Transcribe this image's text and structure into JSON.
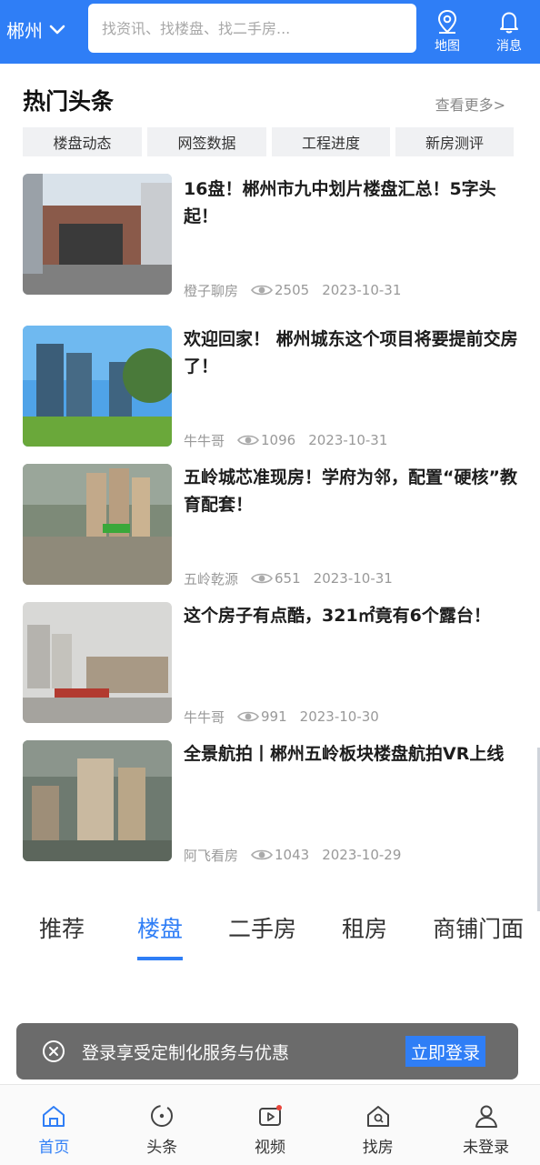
{
  "header": {
    "city": "郴州",
    "search_placeholder": "找资讯、找楼盘、找二手房...",
    "map_label": "地图",
    "message_label": "消息"
  },
  "section": {
    "title": "热门头条",
    "more": "查看更多>",
    "tags": [
      "楼盘动态",
      "网签数据",
      "工程进度",
      "新房测评"
    ]
  },
  "news": [
    {
      "title": "16盘！郴州市九中划片楼盘汇总！5字头起！",
      "author": "橙子聊房",
      "views": "2505",
      "date": "2023-10-31"
    },
    {
      "title": "欢迎回家！ 郴州城东这个项目将要提前交房了！",
      "author": "牛牛哥",
      "views": "1096",
      "date": "2023-10-31"
    },
    {
      "title": "五岭城芯准现房！学府为邻，配置“硬核”教育配套！",
      "author": "五岭乾源",
      "views": "651",
      "date": "2023-10-31"
    },
    {
      "title": "这个房子有点酷，321㎡竟有6个露台！",
      "author": "牛牛哥",
      "views": "991",
      "date": "2023-10-30"
    },
    {
      "title": "全景航拍丨郴州五岭板块楼盘航拍VR上线",
      "author": "阿飞看房",
      "views": "1043",
      "date": "2023-10-29"
    }
  ],
  "categories": [
    "推荐",
    "楼盘",
    "二手房",
    "租房",
    "商铺门面"
  ],
  "active_category": "楼盘",
  "login_banner": {
    "text": "登录享受定制化服务与优惠",
    "button": "立即登录"
  },
  "bottom_nav": [
    "首页",
    "头条",
    "视频",
    "找房",
    "未登录"
  ],
  "colors": {
    "accent": "#2f7ef6"
  }
}
